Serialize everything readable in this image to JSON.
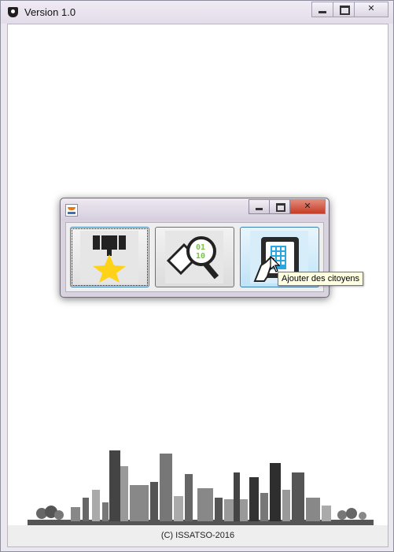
{
  "window": {
    "title": "Version 1.0",
    "icon": "shield-icon"
  },
  "inner_frame": {
    "icon": "java-cup-icon",
    "buttons": [
      {
        "icon": "medal-star-icon"
      },
      {
        "icon": "binary-magnifier-icon"
      },
      {
        "icon": "keypad-safe-hand-icon",
        "tooltip": "Ajouter des citoyens"
      }
    ]
  },
  "footer": {
    "text": "(C) ISSATSO-2016"
  },
  "colors": {
    "star": "#ffd21a",
    "binary_green": "#7bc24b",
    "keypad_blue": "#2aa7df",
    "close_red": "#c53b26",
    "tooltip_bg": "#ffffe1"
  }
}
